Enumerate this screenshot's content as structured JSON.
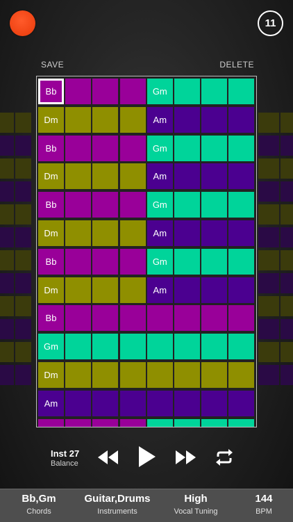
{
  "header": {
    "counter": "11"
  },
  "actions": {
    "save_label": "SAVE",
    "delete_label": "DELETE"
  },
  "colors": {
    "bb": "#990099",
    "gm": "#00d49a",
    "dm": "#8f8f00",
    "am": "#4b0090",
    "dark": "#1f1f1f"
  },
  "rows": [
    [
      "Bb",
      "",
      "",
      "",
      "Gm",
      "",
      "",
      ""
    ],
    [
      "Dm",
      "",
      "",
      "",
      "Am",
      "",
      "",
      ""
    ],
    [
      "Bb",
      "",
      "",
      "",
      "Gm",
      "",
      "",
      ""
    ],
    [
      "Dm",
      "",
      "",
      "",
      "Am",
      "",
      "",
      ""
    ],
    [
      "Bb",
      "",
      "",
      "",
      "Gm",
      "",
      "",
      ""
    ],
    [
      "Dm",
      "",
      "",
      "",
      "Am",
      "",
      "",
      ""
    ],
    [
      "Bb",
      "",
      "",
      "",
      "Gm",
      "",
      "",
      ""
    ],
    [
      "Dm",
      "",
      "",
      "",
      "Am",
      "",
      "",
      ""
    ],
    [
      "Bb",
      "",
      "",
      "",
      "",
      "",
      "",
      ""
    ],
    [
      "Gm",
      "",
      "",
      "",
      "",
      "",
      "",
      ""
    ],
    [
      "Dm",
      "",
      "",
      "",
      "",
      "",
      "",
      ""
    ],
    [
      "Am",
      "",
      "",
      "",
      "",
      "",
      "",
      ""
    ],
    [
      "",
      "",
      "",
      "",
      "",
      "",
      "",
      ""
    ]
  ],
  "row_colors": [
    [
      "bb",
      "bb",
      "bb",
      "bb",
      "gm",
      "gm",
      "gm",
      "gm"
    ],
    [
      "dm",
      "dm",
      "dm",
      "dm",
      "am",
      "am",
      "am",
      "am"
    ],
    [
      "bb",
      "bb",
      "bb",
      "bb",
      "gm",
      "gm",
      "gm",
      "gm"
    ],
    [
      "dm",
      "dm",
      "dm",
      "dm",
      "am",
      "am",
      "am",
      "am"
    ],
    [
      "bb",
      "bb",
      "bb",
      "bb",
      "gm",
      "gm",
      "gm",
      "gm"
    ],
    [
      "dm",
      "dm",
      "dm",
      "dm",
      "am",
      "am",
      "am",
      "am"
    ],
    [
      "bb",
      "bb",
      "bb",
      "bb",
      "gm",
      "gm",
      "gm",
      "gm"
    ],
    [
      "dm",
      "dm",
      "dm",
      "dm",
      "am",
      "am",
      "am",
      "am"
    ],
    [
      "bb",
      "bb",
      "bb",
      "bb",
      "bb",
      "bb",
      "bb",
      "bb"
    ],
    [
      "gm",
      "gm",
      "gm",
      "gm",
      "gm",
      "gm",
      "gm",
      "gm"
    ],
    [
      "dm",
      "dm",
      "dm",
      "dm",
      "dm",
      "dm",
      "dm",
      "dm"
    ],
    [
      "am",
      "am",
      "am",
      "am",
      "am",
      "am",
      "am",
      "am"
    ],
    [
      "bb",
      "bb",
      "bb",
      "bb",
      "gm",
      "gm",
      "gm",
      "gm"
    ]
  ],
  "side_rows": [
    "dm",
    "am",
    "dm",
    "am",
    "dm",
    "am",
    "dm",
    "am",
    "dm",
    "am",
    "dm",
    "am"
  ],
  "player": {
    "title": "Inst 27",
    "subtitle": "Balance"
  },
  "stats": [
    {
      "value": "Bb,Gm",
      "label": "Chords"
    },
    {
      "value": "Guitar,Drums",
      "label": "Instruments"
    },
    {
      "value": "High",
      "label": "Vocal Tuning"
    },
    {
      "value": "144",
      "label": "BPM"
    }
  ],
  "icons": {
    "record": "record-icon",
    "rewind": "rewind-icon",
    "play": "play-icon",
    "fast_forward": "fast-forward-icon",
    "repeat": "repeat-icon"
  }
}
